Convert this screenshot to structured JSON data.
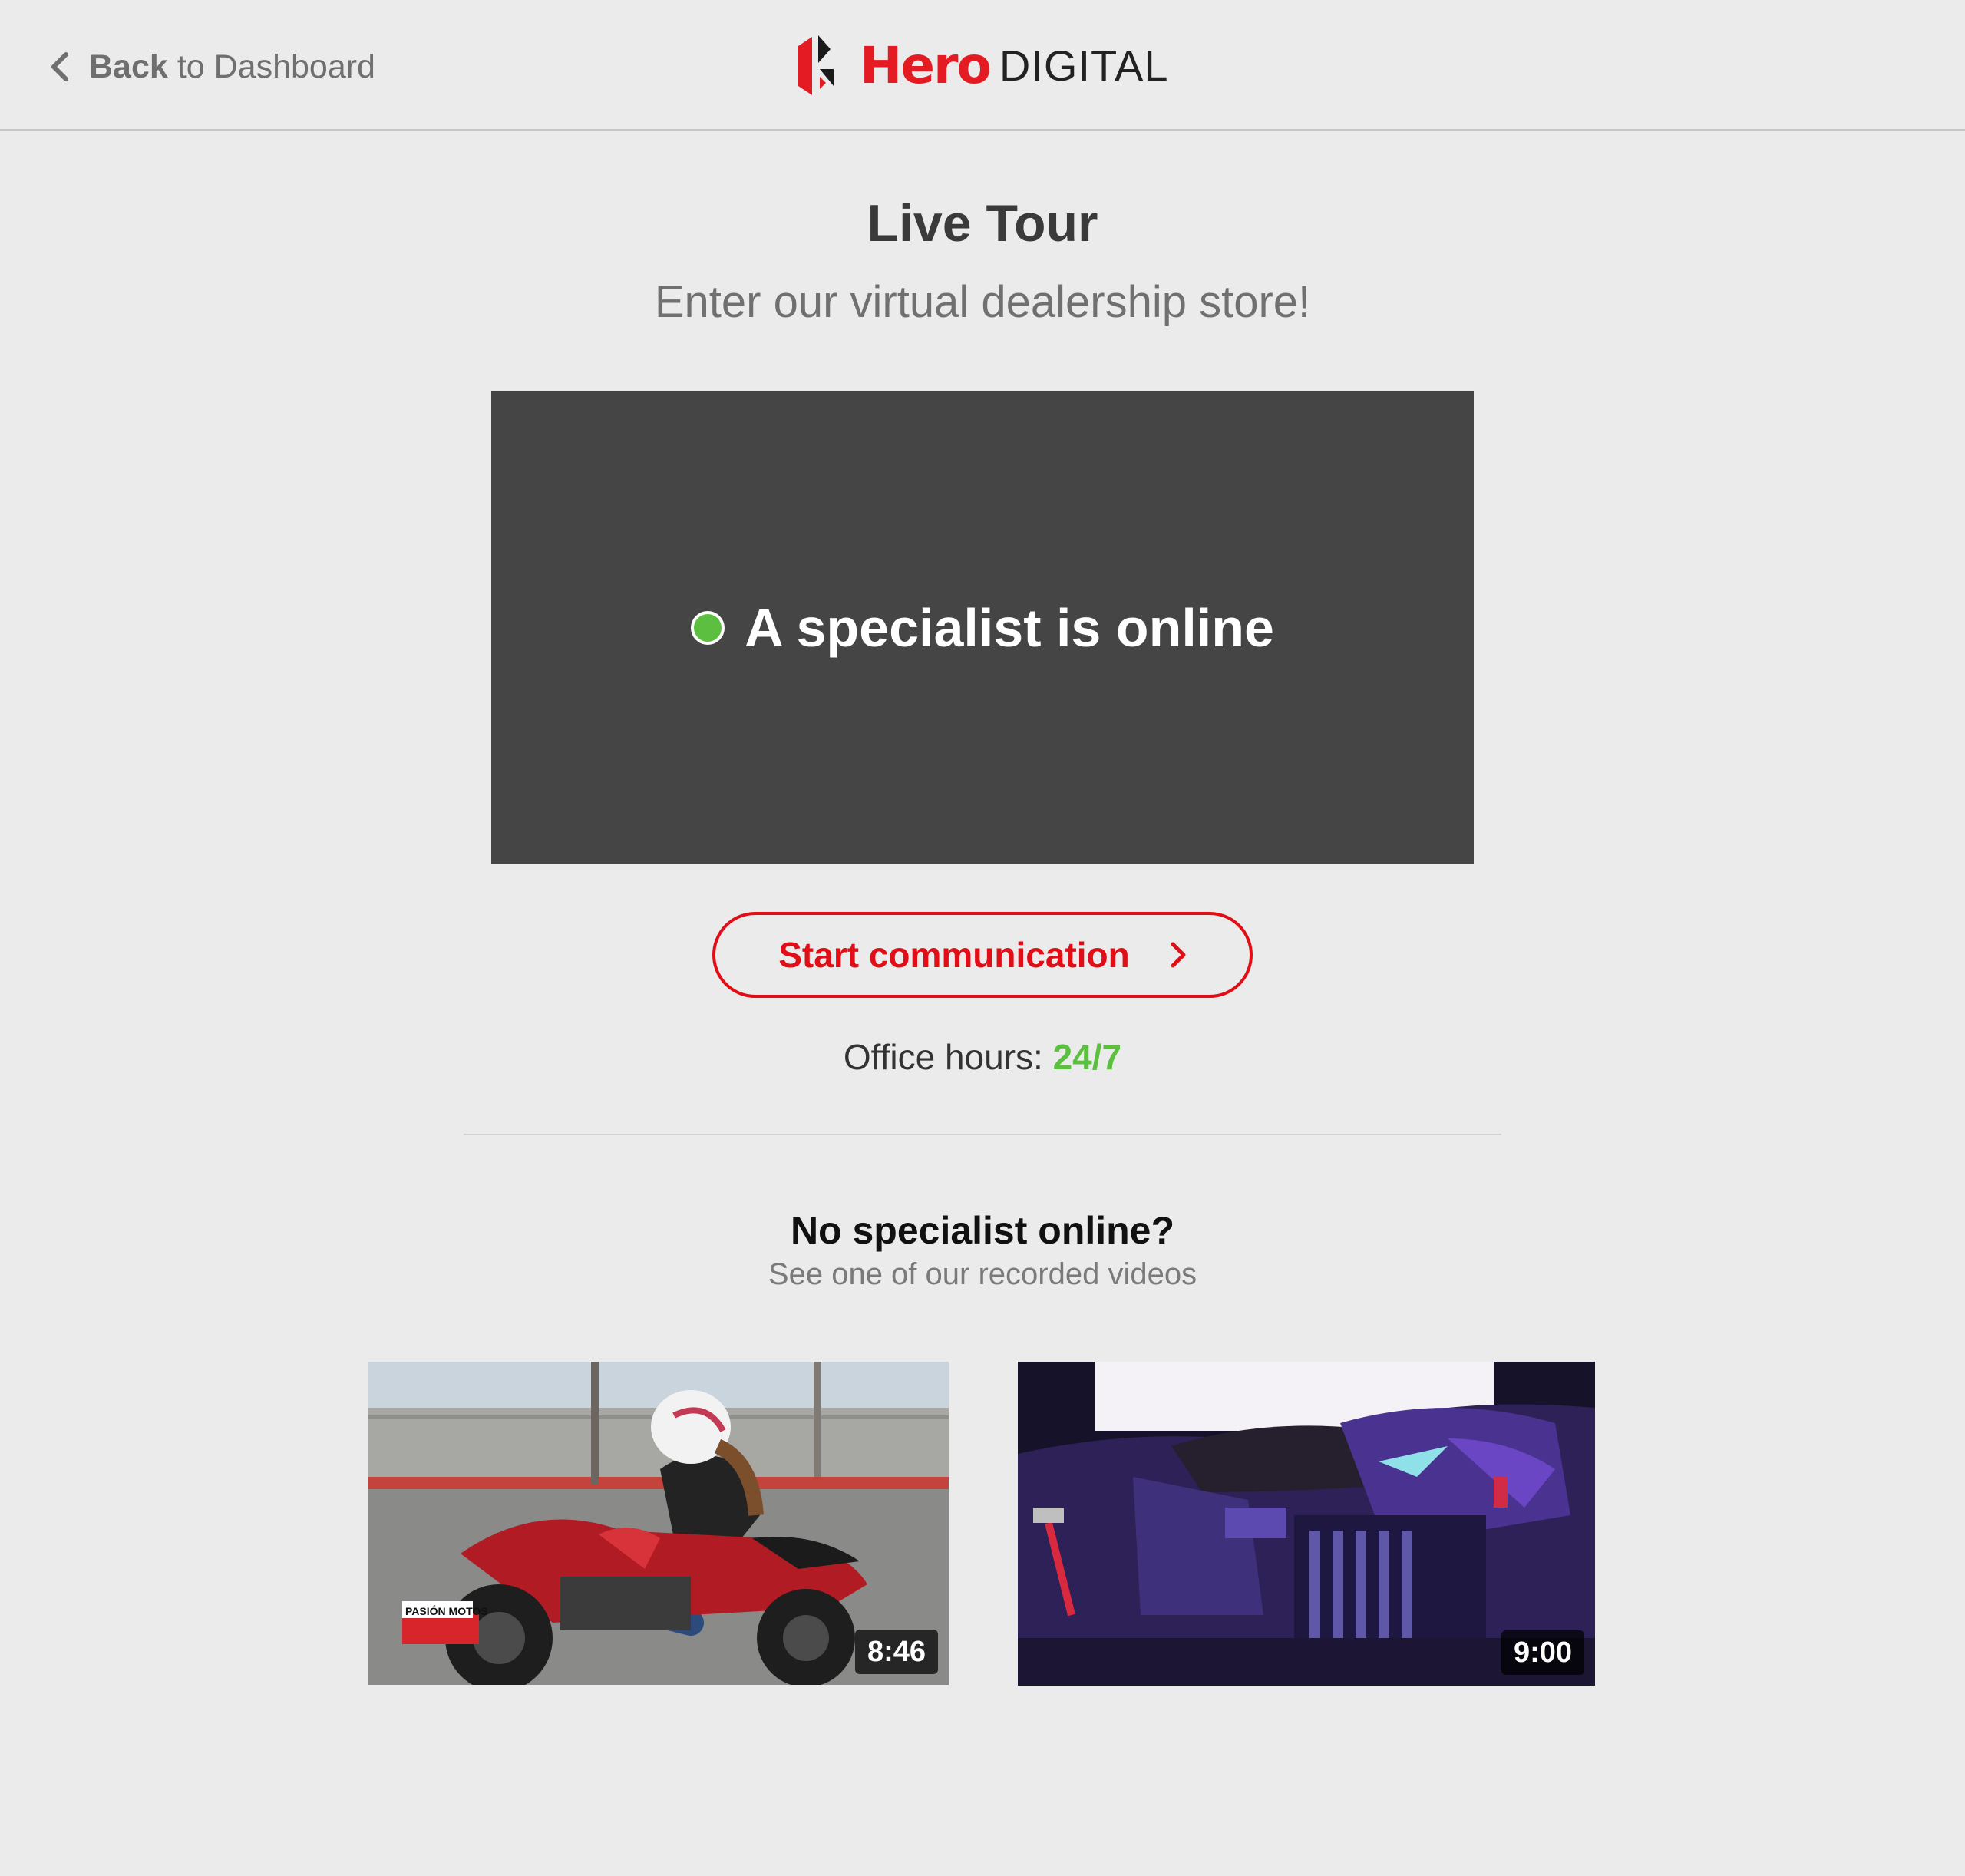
{
  "header": {
    "back_bold": "Back",
    "back_rest": "to Dashboard",
    "logo_hero": "Hero",
    "logo_digital": "DIGITAL"
  },
  "hero": {
    "title": "Live Tour",
    "subtitle": "Enter our virtual dealership store!",
    "status_text": "A specialist is online",
    "cta_label": "Start communication",
    "office_label": "Office hours:",
    "office_hours": "24/7"
  },
  "recorded": {
    "title": "No specialist online?",
    "subtitle": "See one of our recorded videos",
    "videos": [
      {
        "duration": "8:46",
        "overlay": "PASIÓN MOTOS"
      },
      {
        "duration": "9:00"
      }
    ]
  },
  "colors": {
    "brand_red": "#e20e17",
    "online_green": "#5cbf3f",
    "stage_bg": "#454545",
    "page_bg": "#ebebeb"
  },
  "icons": {
    "back": "chevron-left-icon",
    "cta": "chevron-right-icon",
    "status": "online-dot-icon"
  }
}
